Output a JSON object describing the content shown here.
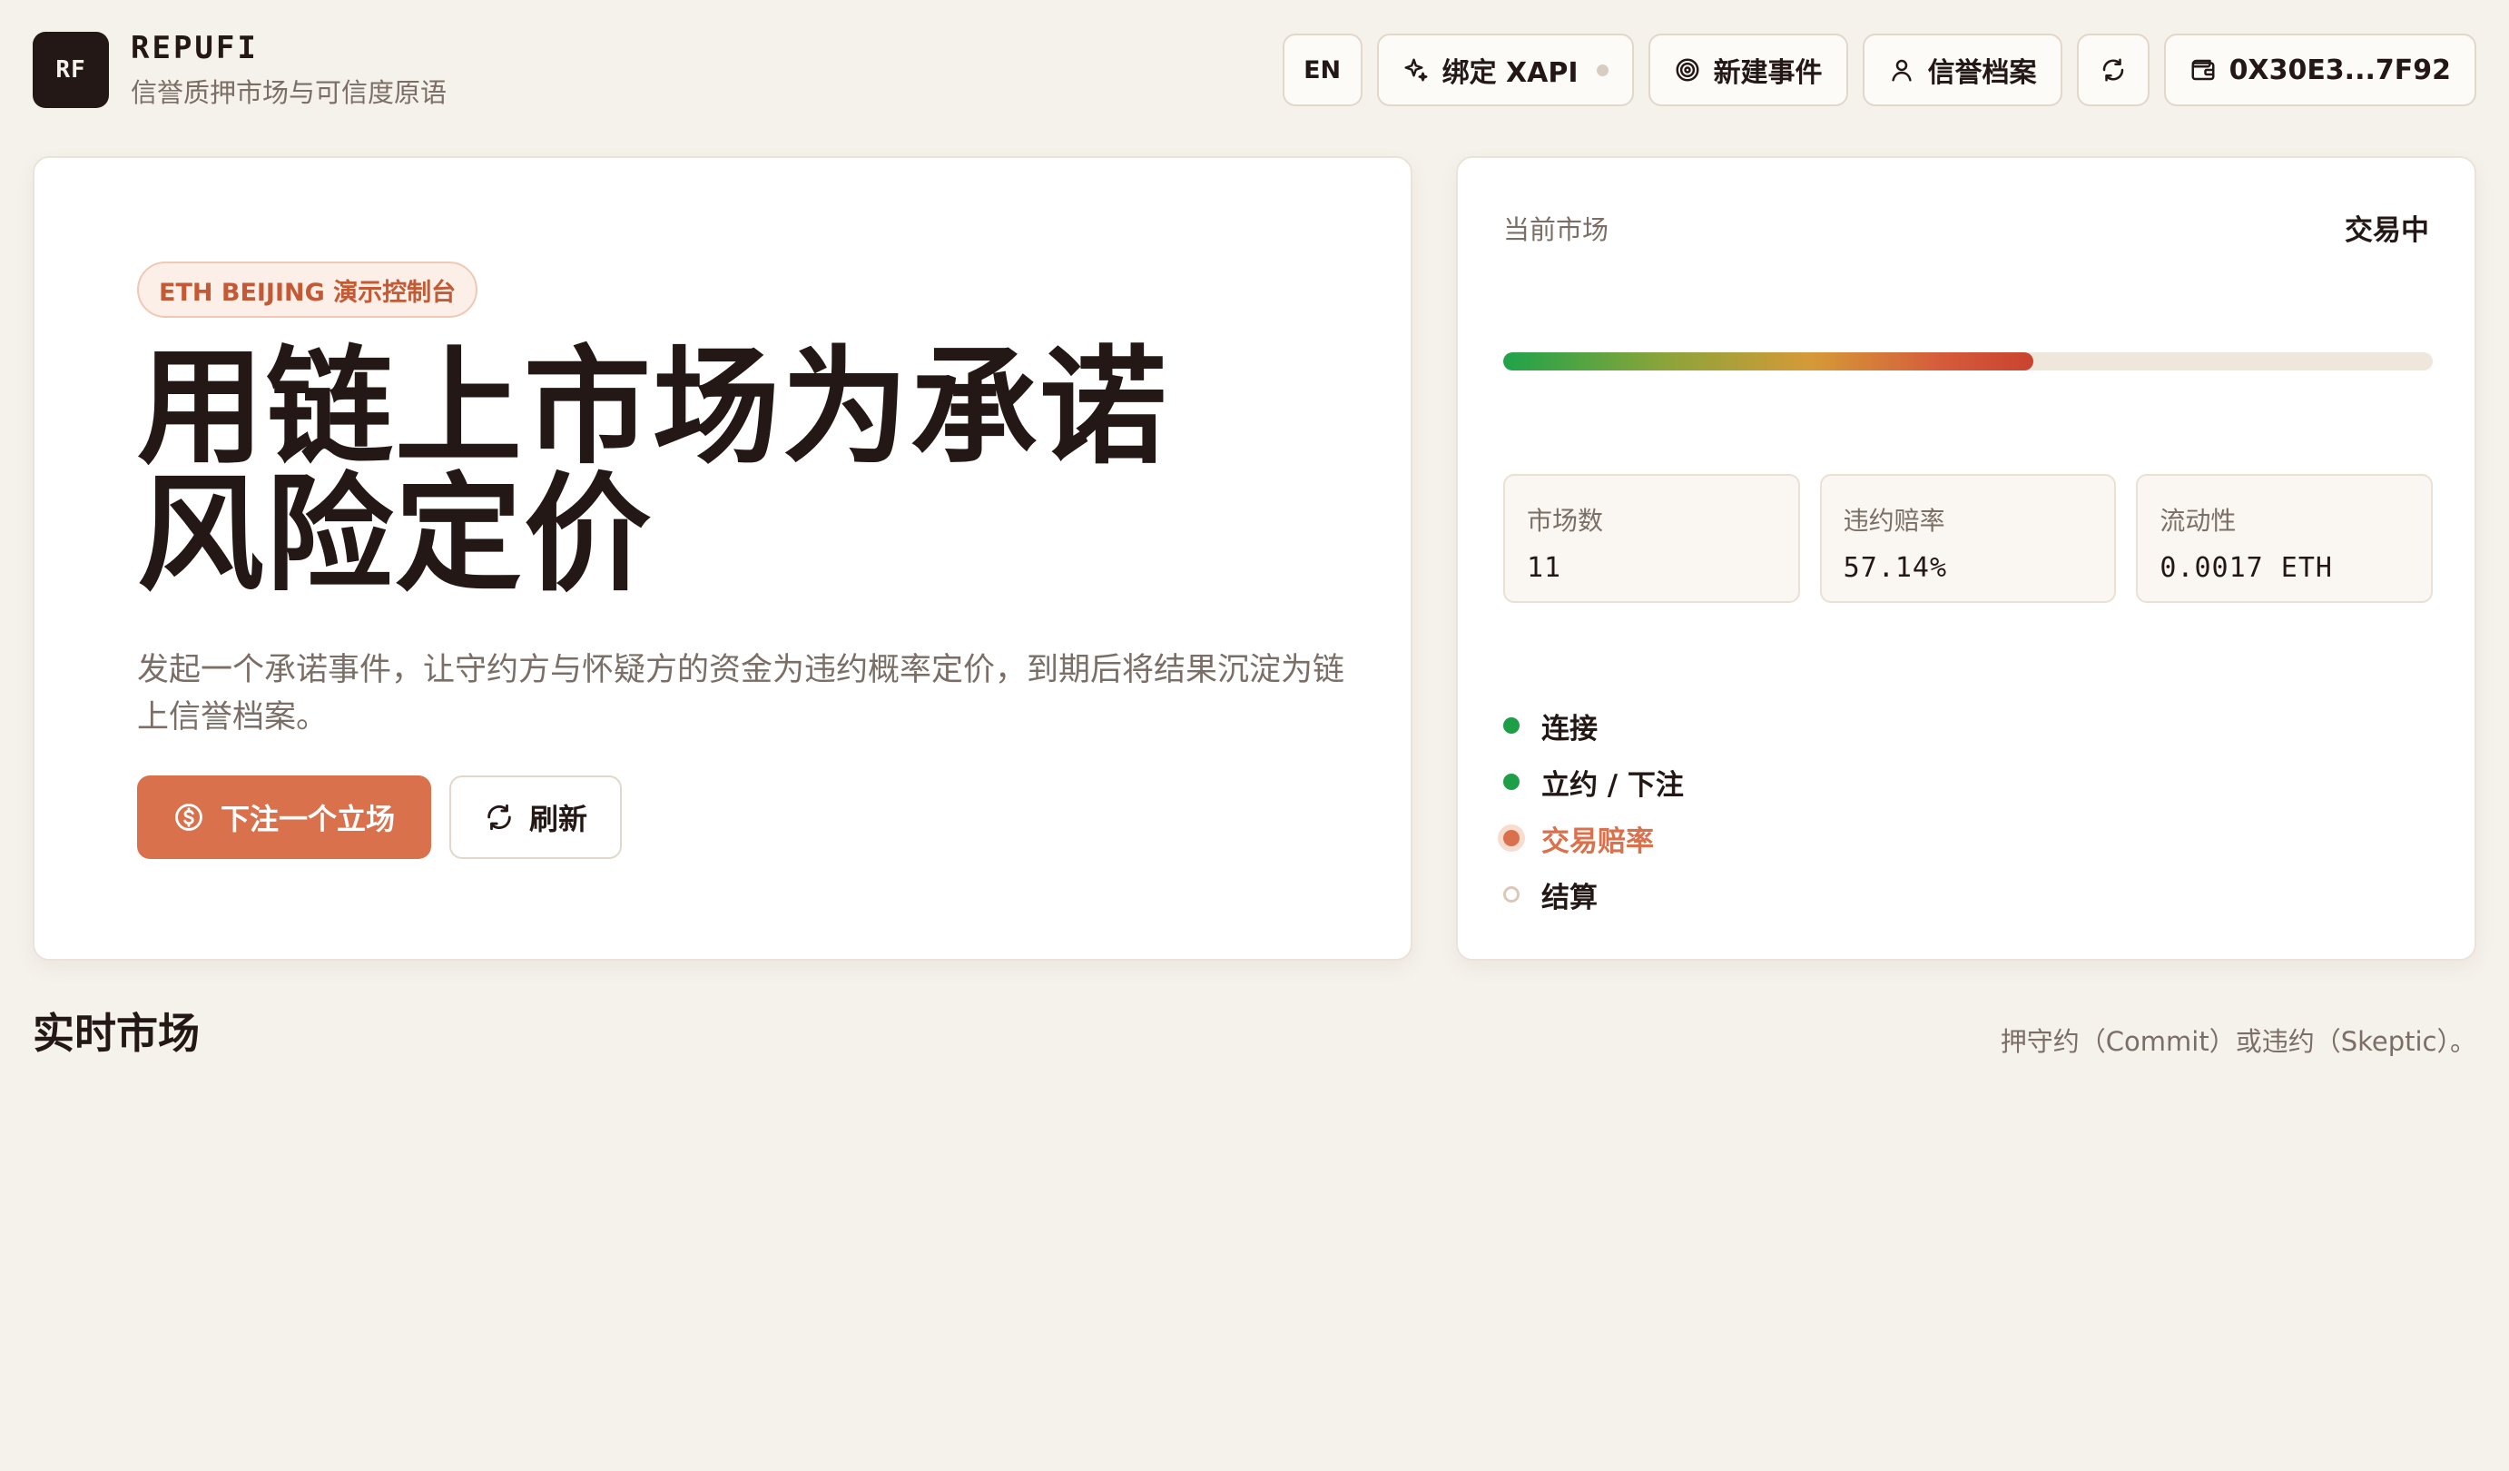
{
  "brand": {
    "logo_text": "RF",
    "name": "REPUFI",
    "subtitle": "信誉质押市场与可信度原语"
  },
  "nav": {
    "lang": "EN",
    "bind_xapi": "绑定 XAPI",
    "new_event": "新建事件",
    "profile": "信誉档案",
    "wallet": "0X30E3...7F92"
  },
  "hero": {
    "pill": "ETH BEIJING 演示控制台",
    "headline_line1": "用链上市场为承诺",
    "headline_line2": "风险定价",
    "description": "发起一个承诺事件，让守约方与怀疑方的资金为违约概率定价，到期后将结果沉淀为链上信誉档案。",
    "primary_button": "下注一个立场",
    "secondary_button": "刷新"
  },
  "market": {
    "label": "当前市场",
    "status": "交易中",
    "progress": 0.57,
    "stats": [
      {
        "label": "市场数",
        "value": "11"
      },
      {
        "label": "违约赔率",
        "value": "57.14%"
      },
      {
        "label": "流动性",
        "value": "0.0017 ETH"
      }
    ],
    "steps": [
      {
        "label": "连接",
        "state": "done"
      },
      {
        "label": "立约 / 下注",
        "state": "done"
      },
      {
        "label": "交易赔率",
        "state": "active"
      },
      {
        "label": "结算",
        "state": "pending"
      }
    ]
  },
  "section": {
    "title": "实时市场",
    "hint": "押守约（Commit）或违约（Skeptic）。"
  },
  "colors": {
    "accent": "#d9714d",
    "success": "#1f9e48",
    "background": "#f5f1eb",
    "ink": "#231815"
  }
}
